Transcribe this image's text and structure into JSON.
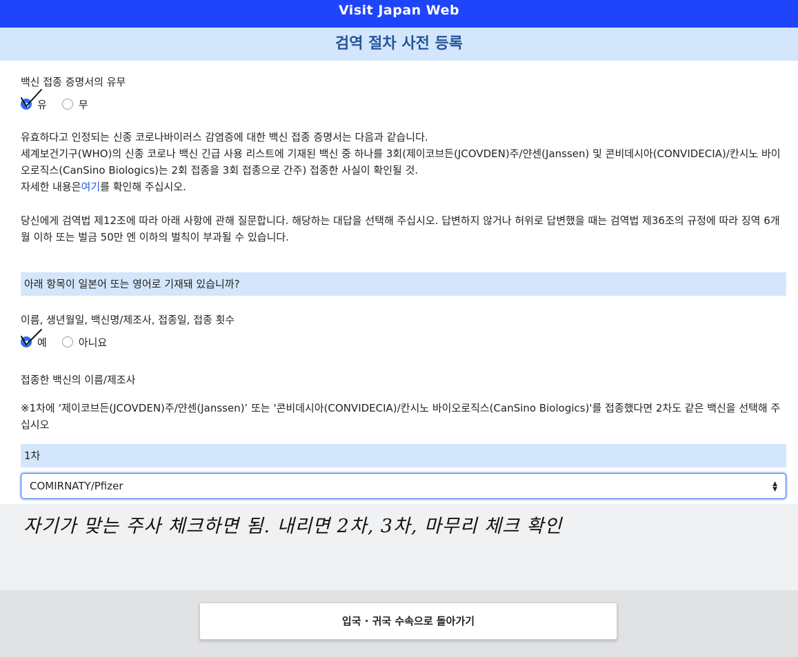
{
  "header": {
    "app_title": "Visit Japan Web",
    "page_title": "검역 절차 사전 등록"
  },
  "vaccine_certificate": {
    "question": "백신 접종 증명서의 유무",
    "options": [
      {
        "label": "유",
        "selected": true
      },
      {
        "label": "무",
        "selected": false
      }
    ]
  },
  "info": {
    "line1": "유효하다고 인정되는 신종 코로나바이러스 감염증에 대한 백신 접종 증명서는 다음과 같습니다.",
    "line2": "세계보건기구(WHO)의 신종 코로나 백신 긴급 사용 리스트에 기재된 백신 중 하나를 3회(제이코브든(JCOVDEN)주/얀센(Janssen) 및 콘비데시아(CONVIDECIA)/칸시노 바이오로직스(CanSino Biologics)는 2회 접종을 3회 접종으로 간주) 접종한 사실이 확인될 것.",
    "more_prefix": "자세한 내용은",
    "more_link": "여기",
    "more_suffix": "를 확인해 주십시오.",
    "legal": "당신에게 검역법 제12조에 따라 아래 사항에 관해 질문합니다. 해당하는 대답을 선택해 주십시오. 답변하지 않거나 허위로 답변했을 때는 검역법 제36조의 규정에 따라 징역 6개월 이하 또는 벌금 50만 엔 이하의 벌칙이 부과될 수 있습니다."
  },
  "language_section": {
    "title": "아래 항목이 일본어 또는 영어로 기재돼 있습니까?",
    "question": "이름, 생년월일, 백신명/제조사, 접종일, 접종 횟수",
    "options": [
      {
        "label": "예",
        "selected": true
      },
      {
        "label": "아니요",
        "selected": false
      }
    ]
  },
  "vaccine_name": {
    "title": "접종한 백신의 이름/제조사",
    "note": "※1차에 ‘제이코브든(JCOVDEN)주/얀센(Janssen)’ 또는 '콘비데시아(CONVIDECIA)/칸시노 바이오로직스(CanSino Biologics)'를 접종했다면 2차도 같은 백신을 선택해 주십시오",
    "dose1_label": "1차",
    "dose1_value": "COMIRNATY/Pfizer"
  },
  "handwritten_note": "자기가 맞는 주사  체크하면 됨. 내리면 2차, 3차, 마무리 체크 확인",
  "footer": {
    "back_button": "입국 · 귀국 수속으로 돌아가기"
  },
  "colors": {
    "brand_blue": "#1f45fa",
    "section_bg": "#d3e6fb",
    "title_text": "#24569a",
    "radio_selected": "#2b6cf2"
  }
}
